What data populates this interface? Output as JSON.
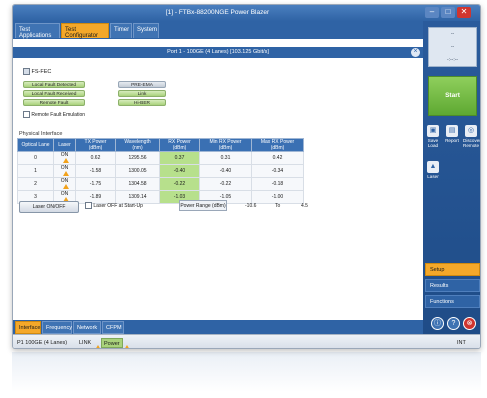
{
  "window": {
    "title": "[1] - FTBx-88200NGE Power Blazer"
  },
  "top_tabs": [
    {
      "label": "Test Applications"
    },
    {
      "label": "Test Configurator"
    },
    {
      "label": "Timer"
    },
    {
      "label": "System"
    }
  ],
  "port_header": "Port 1 - 100GE (4 Lanes) [103.125 Gbit/s]",
  "fs_fec_label": "FS-FEC",
  "status_pills": {
    "local_fault_detected": "Local Fault Detected",
    "local_fault_received": "Local Fault Received",
    "remote_fault": "Remote Fault",
    "pre_emphasis": "PRE-EMA",
    "link": "Link",
    "hi_ber": "Hi-BER"
  },
  "remote_fault_emulation": "Remote Fault Emulation",
  "physical_interface": {
    "title": "Physical Interface",
    "columns": [
      "Optical Lane",
      "Laser",
      "TX Power (dBm)",
      "Wavelength (nm)",
      "RX Power (dBm)",
      "Min RX Power (dBm)",
      "Max RX Power (dBm)"
    ],
    "rows": [
      {
        "lane": "0",
        "laser": "ON",
        "tx": "0.62",
        "wl": "1295.56",
        "rx": "0.37",
        "min": "0.31",
        "max": "0.42"
      },
      {
        "lane": "1",
        "laser": "ON",
        "tx": "-1.58",
        "wl": "1300.05",
        "rx": "-0.40",
        "min": "-0.40",
        "max": "-0.34"
      },
      {
        "lane": "2",
        "laser": "ON",
        "tx": "-1.75",
        "wl": "1304.58",
        "rx": "-0.22",
        "min": "-0.22",
        "max": "-0.18"
      },
      {
        "lane": "3",
        "laser": "ON",
        "tx": "-1.89",
        "wl": "1309.14",
        "rx": "-1.03",
        "min": "-1.05",
        "max": "-1.00"
      }
    ]
  },
  "laser_button": "Laser ON/OFF",
  "laser_off_startup": "Laser OFF at Start-Up",
  "power_range": {
    "label": "Power Range (dBm)",
    "low": "-10.6",
    "to": "To",
    "high": "4.5"
  },
  "bottom_tabs": [
    {
      "label": "Interface"
    },
    {
      "label": "Frequency"
    },
    {
      "label": "Network"
    },
    {
      "label": "CFPM"
    }
  ],
  "status_bar": {
    "port": "P1 100GE (4 Lanes)",
    "link": "LINK",
    "power": "Power",
    "right": "INT"
  },
  "right_panel": {
    "info_lines": [
      "--",
      "--",
      "-:--:--"
    ],
    "start": "Start",
    "icons": [
      {
        "label": "Save Load",
        "icon": "save-icon"
      },
      {
        "label": "Report",
        "icon": "report-icon"
      },
      {
        "label": "Discover Remote",
        "icon": "discover-icon"
      },
      {
        "label": "Laser",
        "icon": "laser-icon"
      }
    ],
    "menu": [
      {
        "label": "Setup"
      },
      {
        "label": "Results"
      },
      {
        "label": "Functions"
      }
    ]
  },
  "colors": {
    "accent_orange": "#f4a82a",
    "brand_blue": "#2f63a5",
    "ok_green": "#a9d27b",
    "start_green": "#5ea932",
    "close_red": "#d0352f"
  }
}
